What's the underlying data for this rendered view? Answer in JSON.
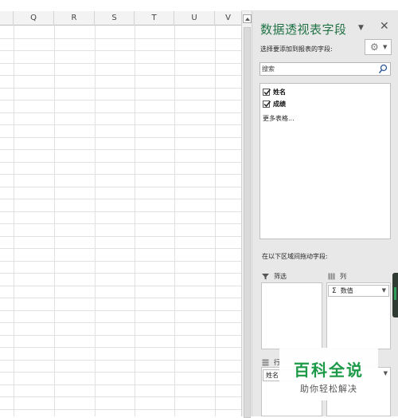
{
  "grid": {
    "columns": [
      "Q",
      "R",
      "S",
      "T",
      "U",
      "V"
    ]
  },
  "pivot_pane": {
    "title": "数据透视表字段",
    "choose_fields_label": "选择要添加到报表的字段:",
    "search": {
      "placeholder": "搜索",
      "icon": "search-icon"
    },
    "fields": [
      {
        "label": "姓名",
        "checked": true
      },
      {
        "label": "成绩",
        "checked": true
      }
    ],
    "more_tables": "更多表格...",
    "drag_label": "在以下区域间拖动字段:",
    "areas": {
      "filters": {
        "label": "筛选",
        "icon": "filter-icon"
      },
      "columns": {
        "label": "列",
        "icon": "columns-icon",
        "items": [
          {
            "label": "数值",
            "icon": "sigma-icon"
          }
        ]
      },
      "rows": {
        "label": "行",
        "icon": "rows-icon",
        "items": [
          {
            "label": "姓名"
          }
        ]
      },
      "values": {
        "items": []
      }
    }
  },
  "watermark": {
    "title": "百科全说",
    "subtitle": "助你轻松解决"
  },
  "colors": {
    "accent": "#217346",
    "watermark": "#1c9a48"
  }
}
